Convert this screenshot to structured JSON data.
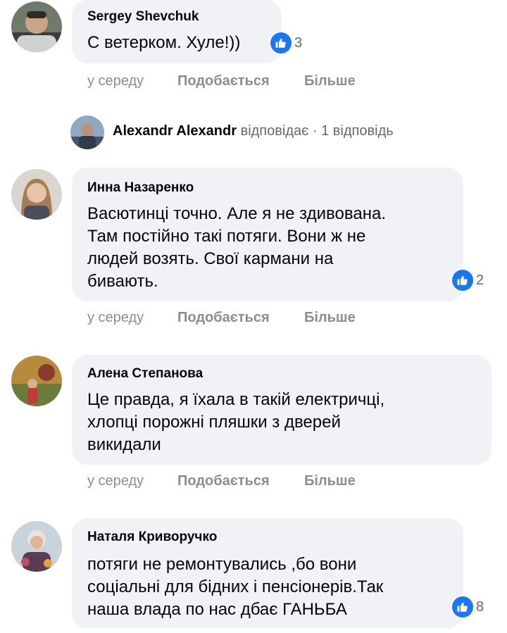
{
  "comments": [
    {
      "author": "Sergey Shevchuk",
      "lines": [
        "С ветерком. Хуле!))"
      ],
      "likes": "3",
      "time": "у середу",
      "like_label": "Подобається",
      "more_label": "Більше"
    },
    {
      "author": "Инна Назаренко",
      "lines": [
        "Васютинці точно. Але я не здивована.",
        "Там постійно такі потяги. Вони ж не",
        "людей возять. Свої кармани на",
        "бивають."
      ],
      "likes": "2",
      "time": "у середу",
      "like_label": "Подобається",
      "more_label": "Більше"
    },
    {
      "author": "Алена Степанова",
      "lines": [
        "Це правда, я їхала в такій електричці,",
        "хлопці порожні пляшки з дверей",
        "викидали"
      ],
      "time": "у середу",
      "like_label": "Подобається",
      "more_label": "Більше"
    },
    {
      "author": "Наталя Криворучко",
      "lines": [
        "потяги не ремонтувались ,бо вони",
        "соціальні для бідних і пенсіонерів.Так",
        "наша влада по нас дбає ГАНЬБА"
      ],
      "likes": "8"
    }
  ],
  "reply_thread": {
    "name": "Alexandr Alexandr",
    "verb": "відповідає",
    "separator": "·",
    "count_label": "1 відповідь"
  },
  "colors": {
    "bubble": "#f0f2f5",
    "like_blue": "#1877f2",
    "meta_gray": "#8a8d91"
  },
  "icons": [
    "thumbs-up-icon",
    "avatar"
  ]
}
